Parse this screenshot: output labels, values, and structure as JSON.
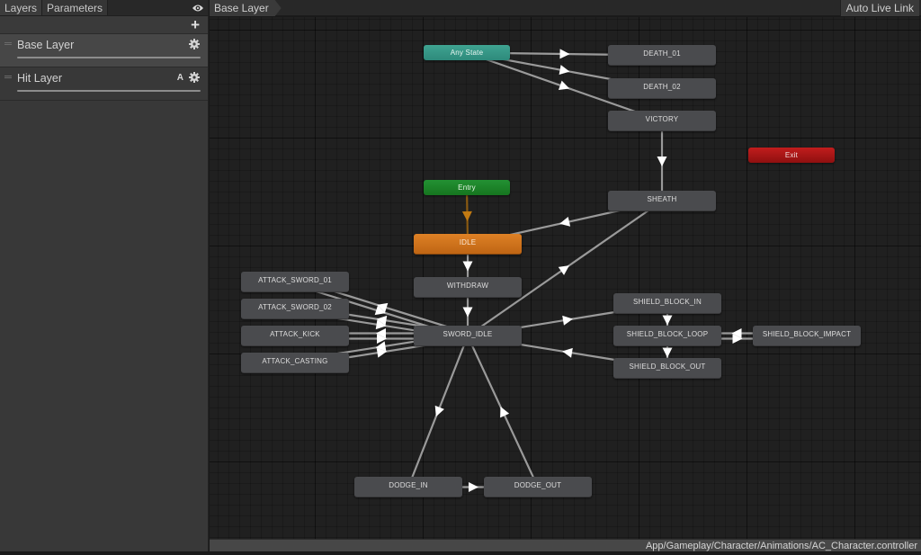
{
  "left_panel": {
    "tabs": [
      {
        "label": "Layers",
        "active": true
      },
      {
        "label": "Parameters",
        "active": false
      }
    ],
    "visibility_icon": "eye-icon",
    "add_icon": "plus-icon",
    "add_symbol": "+",
    "layers": [
      {
        "name": "Base Layer",
        "selected": true,
        "badge": "",
        "icon": "gear-icon"
      },
      {
        "name": "Hit Layer",
        "selected": false,
        "badge": "A",
        "icon": "gear-icon"
      }
    ]
  },
  "graph": {
    "breadcrumb": "Base Layer",
    "auto_live_link": "Auto Live Link",
    "status_path": "App/Gameplay/Character/Animations/AC_Character.controller",
    "colors": {
      "any_state": "#3a9a8a",
      "entry": "#1e8a2d",
      "exit": "#b01818",
      "default_state": "#d47520",
      "state": "#4a4b4e",
      "transition": "#9a9a9a",
      "entry_transition": "#8a5a12"
    },
    "nodes": {
      "any_state": "Any State",
      "entry": "Entry",
      "exit": "Exit",
      "death_01": "DEATH_01",
      "death_02": "DEATH_02",
      "victory": "VICTORY",
      "sheath": "SHEATH",
      "idle": "IDLE",
      "withdraw": "WITHDRAW",
      "sword_idle": "SWORD_IDLE",
      "attack_sword_01": "ATTACK_SWORD_01",
      "attack_sword_02": "ATTACK_SWORD_02",
      "attack_kick": "ATTACK_KICK",
      "attack_casting": "ATTACK_CASTING",
      "shield_block_in": "SHIELD_BLOCK_IN",
      "shield_block_loop": "SHIELD_BLOCK_LOOP",
      "shield_block_impact": "SHIELD_BLOCK_IMPACT",
      "shield_block_out": "SHIELD_BLOCK_OUT",
      "dodge_in": "DODGE_IN",
      "dodge_out": "DODGE_OUT"
    },
    "default_state": "idle",
    "transitions": [
      {
        "from": "any_state",
        "to": "death_01"
      },
      {
        "from": "any_state",
        "to": "death_02"
      },
      {
        "from": "any_state",
        "to": "victory"
      },
      {
        "from": "victory",
        "to": "sheath"
      },
      {
        "from": "sheath",
        "to": "idle"
      },
      {
        "from": "entry",
        "to": "idle",
        "kind": "entry"
      },
      {
        "from": "idle",
        "to": "withdraw"
      },
      {
        "from": "withdraw",
        "to": "sword_idle"
      },
      {
        "from": "sword_idle",
        "to": "sheath"
      },
      {
        "from": "attack_sword_01",
        "to": "sword_idle"
      },
      {
        "from": "sword_idle",
        "to": "attack_sword_01"
      },
      {
        "from": "attack_sword_02",
        "to": "sword_idle"
      },
      {
        "from": "sword_idle",
        "to": "attack_sword_02"
      },
      {
        "from": "attack_kick",
        "to": "sword_idle"
      },
      {
        "from": "sword_idle",
        "to": "attack_kick"
      },
      {
        "from": "attack_casting",
        "to": "sword_idle"
      },
      {
        "from": "sword_idle",
        "to": "attack_casting"
      },
      {
        "from": "sword_idle",
        "to": "shield_block_in"
      },
      {
        "from": "shield_block_in",
        "to": "shield_block_loop"
      },
      {
        "from": "shield_block_loop",
        "to": "shield_block_impact"
      },
      {
        "from": "shield_block_impact",
        "to": "shield_block_loop"
      },
      {
        "from": "shield_block_loop",
        "to": "shield_block_out"
      },
      {
        "from": "shield_block_out",
        "to": "sword_idle"
      },
      {
        "from": "sword_idle",
        "to": "dodge_in"
      },
      {
        "from": "dodge_in",
        "to": "dodge_out"
      },
      {
        "from": "dodge_out",
        "to": "sword_idle"
      }
    ]
  }
}
